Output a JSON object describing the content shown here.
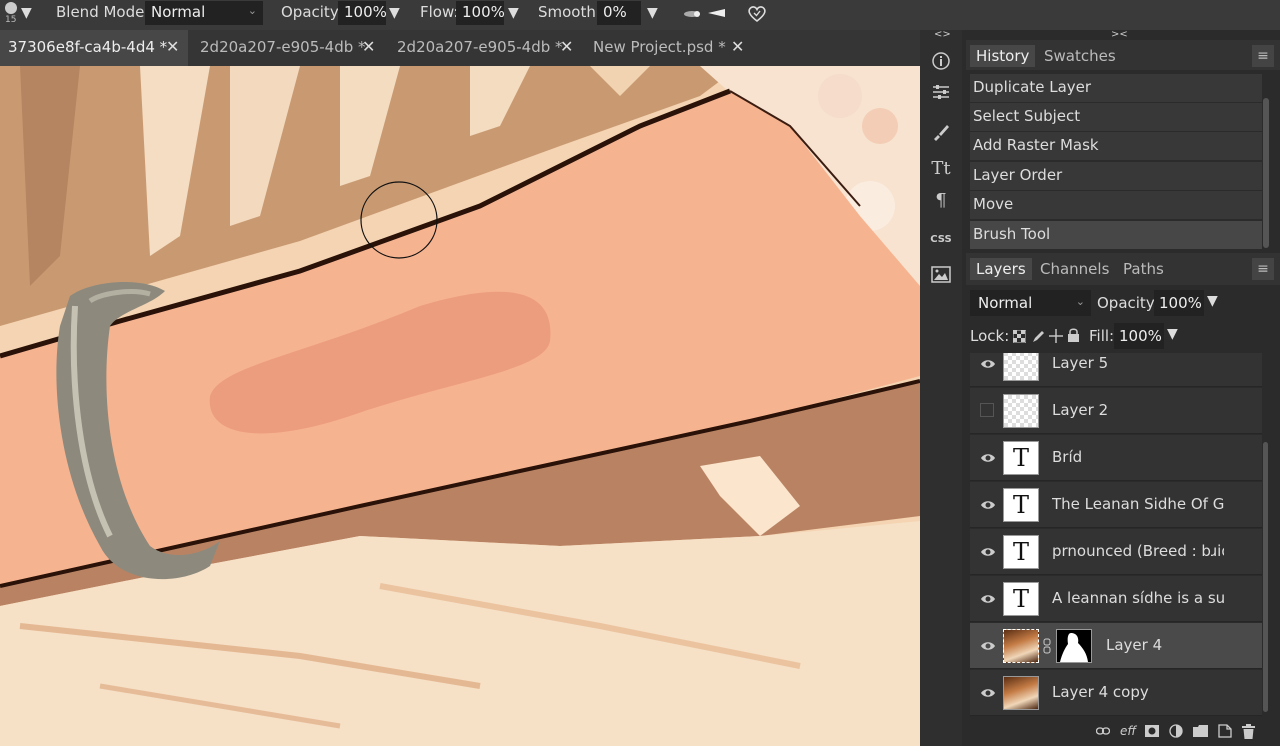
{
  "toolbar": {
    "brush_size": "15",
    "blend_mode_label": "Blend Mode:",
    "blend_mode_value": "Normal",
    "opacity_label": "Opacity:",
    "opacity_value": "100%",
    "flow_label": "Flow:",
    "flow_value": "100%",
    "smooth_label": "Smooth:",
    "smooth_value": "0%"
  },
  "tabs": [
    {
      "label": "37306e8f-ca4b-4d4 *",
      "active": true
    },
    {
      "label": "2d20a207-e905-4db *",
      "active": false
    },
    {
      "label": "2d20a207-e905-4db *",
      "active": false
    },
    {
      "label": "New Project.psd *",
      "active": false
    }
  ],
  "tool_strip": {
    "collapse_glyph": "<>",
    "css_label": "CSS",
    "type_glyph": "Tt",
    "para_glyph": "¶"
  },
  "history_panel": {
    "expand_glyph": "><",
    "tabs": [
      "History",
      "Swatches"
    ],
    "items": [
      "Duplicate Layer",
      "Select Subject",
      "Add Raster Mask",
      "Layer Order",
      "Move",
      "Brush Tool"
    ]
  },
  "layers_panel": {
    "tabs": [
      "Layers",
      "Channels",
      "Paths"
    ],
    "blend_mode": "Normal",
    "opacity_label": "Opacity:",
    "opacity_value": "100%",
    "lock_label": "Lock:",
    "fill_label": "Fill:",
    "fill_value": "100%",
    "layers": [
      {
        "name": "Layer 5",
        "visible": true,
        "type": "empty"
      },
      {
        "name": "Layer 2",
        "visible": false,
        "type": "empty"
      },
      {
        "name": "Bríd",
        "visible": true,
        "type": "text"
      },
      {
        "name": "The Leanan Sidhe Of Gal",
        "visible": true,
        "type": "text"
      },
      {
        "name": "prnounced (Breed : bɹid)",
        "visible": true,
        "type": "text"
      },
      {
        "name": "A leannan sídhe is a supe",
        "visible": true,
        "type": "text"
      },
      {
        "name": "Layer 4",
        "visible": true,
        "type": "photo-mask",
        "selected": true
      },
      {
        "name": "Layer 4 copy",
        "visible": true,
        "type": "photo"
      }
    ],
    "text_thumb_glyph": "T"
  },
  "colors": {
    "skin": "#f3b08c",
    "outline": "#2a1208",
    "background_wood": "#c8926a",
    "panel_bg": "#2b2b2b"
  }
}
